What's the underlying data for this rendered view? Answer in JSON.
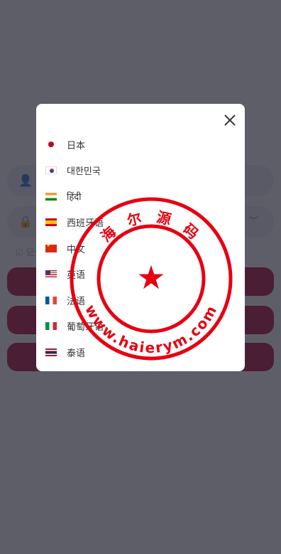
{
  "login": {
    "remember_label": "记住"
  },
  "language_modal": {
    "items": [
      {
        "label": "日本",
        "flag": "jp-flag-icon"
      },
      {
        "label": "대한민국",
        "flag": "kr-flag-icon"
      },
      {
        "label": "हिंदी",
        "flag": "in-flag-icon"
      },
      {
        "label": "西班牙语",
        "flag": "es-flag-icon"
      },
      {
        "label": "中文",
        "flag": "cn-flag-icon"
      },
      {
        "label": "英语",
        "flag": "us-flag-icon"
      },
      {
        "label": "法语",
        "flag": "fr-flag-icon"
      },
      {
        "label": "葡萄牙语",
        "flag": "it-flag-icon"
      },
      {
        "label": "泰语",
        "flag": "th-flag-icon"
      }
    ]
  },
  "watermark": {
    "top_text": "海 尔 源 码",
    "bottom_text": "www.haierym.com",
    "color": "#e60012"
  },
  "colors": {
    "overlay": "#5a5a68",
    "accent": "#b0002a"
  }
}
